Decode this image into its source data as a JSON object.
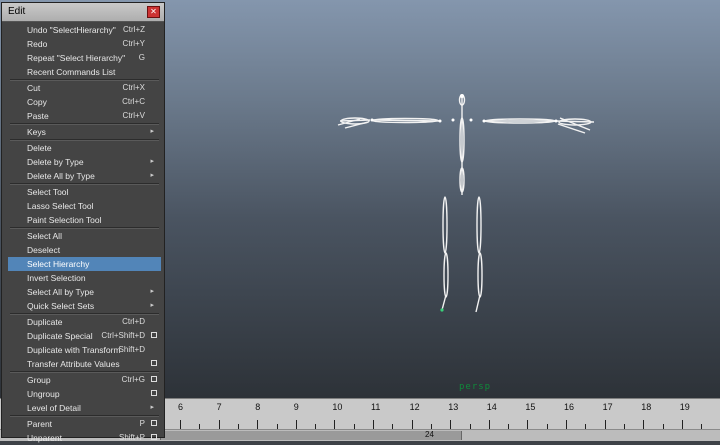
{
  "menu": {
    "title": "Edit",
    "close_icon": "close-icon",
    "sections": [
      [
        {
          "label": "Undo \"SelectHierarchy\"",
          "shortcut": "Ctrl+Z"
        },
        {
          "label": "Redo",
          "shortcut": "Ctrl+Y"
        },
        {
          "label": "Repeat \"Select Hierarchy\"",
          "shortcut": "G"
        },
        {
          "label": "Recent Commands List"
        }
      ],
      [
        {
          "label": "Cut",
          "shortcut": "Ctrl+X"
        },
        {
          "label": "Copy",
          "shortcut": "Ctrl+C"
        },
        {
          "label": "Paste",
          "shortcut": "Ctrl+V"
        }
      ],
      [
        {
          "label": "Keys",
          "submenu": true
        }
      ],
      [
        {
          "label": "Delete"
        },
        {
          "label": "Delete by Type",
          "submenu": true
        },
        {
          "label": "Delete All by Type",
          "submenu": true
        }
      ],
      [
        {
          "label": "Select Tool"
        },
        {
          "label": "Lasso Select Tool"
        },
        {
          "label": "Paint Selection Tool"
        }
      ],
      [
        {
          "label": "Select All"
        },
        {
          "label": "Deselect"
        },
        {
          "label": "Select Hierarchy",
          "active": true
        },
        {
          "label": "Invert Selection"
        },
        {
          "label": "Select All by Type",
          "submenu": true
        },
        {
          "label": "Quick Select Sets",
          "submenu": true
        }
      ],
      [
        {
          "label": "Duplicate",
          "shortcut": "Ctrl+D"
        },
        {
          "label": "Duplicate Special",
          "shortcut": "Ctrl+Shift+D",
          "option": true
        },
        {
          "label": "Duplicate with Transform",
          "shortcut": "Shift+D"
        },
        {
          "label": "Transfer Attribute Values",
          "option": true
        }
      ],
      [
        {
          "label": "Group",
          "shortcut": "Ctrl+G",
          "option": true
        },
        {
          "label": "Ungroup",
          "option": true
        },
        {
          "label": "Level of Detail",
          "submenu": true
        }
      ],
      [
        {
          "label": "Parent",
          "shortcut": "P",
          "option": true
        },
        {
          "label": "Unparent",
          "shortcut": "Shift+P",
          "option": true
        }
      ]
    ]
  },
  "viewport": {
    "camera_label": "persp"
  },
  "timeline": {
    "frames": [
      "6",
      "7",
      "8",
      "9",
      "10",
      "11",
      "12",
      "13",
      "14",
      "15",
      "16",
      "17",
      "18",
      "19"
    ]
  },
  "range": {
    "end_value": "24"
  },
  "colors": {
    "menu_bg": "#444444",
    "highlight": "#5285b8",
    "camera_label": "#0f8a3a"
  }
}
